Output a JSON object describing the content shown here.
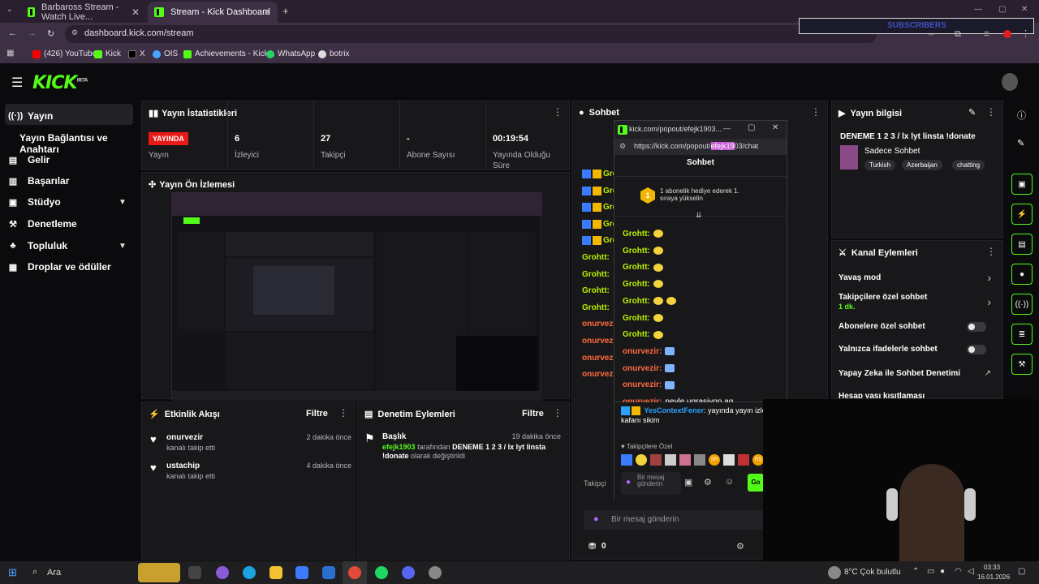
{
  "browser": {
    "tabs": [
      {
        "title": "Barbaross Stream - Watch Live..."
      },
      {
        "title": "Stream - Kick Dashboard"
      }
    ],
    "url": "dashboard.kick.com/stream",
    "bookmarks": [
      "(426) YouTube",
      "Kick",
      "X",
      "OIS",
      "Achievements - Kick...",
      "WhatsApp",
      "botrix"
    ]
  },
  "kick": {
    "logo": "KICK",
    "logo_sup": "BETA"
  },
  "sidebar": {
    "items": [
      {
        "label": "Yayın",
        "icon": "broadcast-icon"
      },
      {
        "label": "Yayın Bağlantısı ve Anahtarı",
        "icon": ""
      },
      {
        "label": "Gelir",
        "icon": "revenue-icon"
      },
      {
        "label": "Başarılar",
        "icon": "achievements-icon"
      },
      {
        "label": "Stüdyo",
        "icon": "studio-icon"
      },
      {
        "label": "Denetleme",
        "icon": "moderation-icon"
      },
      {
        "label": "Topluluk",
        "icon": "community-icon"
      },
      {
        "label": "Droplar ve ödüller",
        "icon": "drops-icon"
      }
    ]
  },
  "stats": {
    "title": "Yayın İstatistikleri",
    "live_badge": "YAYINDA",
    "live_label": "Yayın",
    "items": [
      {
        "value": "6",
        "label": "İzleyici"
      },
      {
        "value": "27",
        "label": "Takipçi"
      },
      {
        "value": "-",
        "label": "Abone Sayısı"
      },
      {
        "value": "00:19:54",
        "label": "Yayında Olduğu Süre"
      }
    ]
  },
  "preview": {
    "title": "Yayın Ön İzlemesi"
  },
  "activity": {
    "title": "Etkinlik Akışı",
    "filter": "Filtre",
    "items": [
      {
        "user": "onurvezir",
        "action": "kanalı takip etti",
        "time": "2 dakika önce"
      },
      {
        "user": "ustachip",
        "action": "kanalı takip etti",
        "time": "4 dakika önce"
      }
    ]
  },
  "modlog": {
    "title": "Denetim Eylemleri",
    "filter": "Filtre",
    "item": {
      "heading": "Başlık",
      "user": "efejk1903",
      "middle": "tarafından",
      "value": "DENEME 1 2 3 / lx lyt linsta !donate",
      "suffix": "olarak değiştirildi",
      "time": "19 dakika önce"
    }
  },
  "chat": {
    "title": "Sohbet",
    "bg_users": [
      "Grohtt:",
      "Grohtt:",
      "Grohtt:",
      "Grohtt:",
      "Grohtt:",
      "Grohtt:",
      "Grohtt:",
      "Grohtt:",
      "Grohtt:",
      "onurvezir",
      "onurvezir",
      "onurvezir",
      "onurvezir"
    ],
    "followers_only": "Takipçi",
    "input_placeholder": "Bir mesaj gönderin",
    "points": "0"
  },
  "popout": {
    "window_title": "kick.com/popout/efejk1903...",
    "url_prefix": "https://kick.com/popout/",
    "url_highlight": "efejk19",
    "url_suffix": "03/chat",
    "header": "Sohbet",
    "pinned_rank": "1",
    "pinned_text": "1 abonelik hediye ederek 1. sıraya yükselin",
    "messages": [
      {
        "user": "Grohtt:",
        "text": "",
        "emotes": 1
      },
      {
        "user": "Grohtt:",
        "text": "",
        "emotes": 1
      },
      {
        "user": "Grohtt:",
        "text": "",
        "emotes": 1
      },
      {
        "user": "Grohtt:",
        "text": "",
        "emotes": 1
      },
      {
        "user": "Grohtt:",
        "text": "",
        "emotes": 2
      },
      {
        "user": "Grohtt:",
        "text": "",
        "emotes": 1
      },
      {
        "user": "Grohtt:",
        "text": "",
        "emotes": 1
      },
      {
        "user": "onurvezir:",
        "text": "",
        "emotes": 1
      },
      {
        "user": "onurvezir:",
        "text": "",
        "emotes": 1
      },
      {
        "user": "onurvezir:",
        "text": "",
        "emotes": 1
      },
      {
        "user": "onurvezir:",
        "text": "neyle ugrasiyon aq",
        "emotes": 0
      }
    ],
    "highlight_user": "YesContextFener",
    "highlight_text": ": yayında yayın izleyen kafanı sikim",
    "followers_label": "Takipçilere Özel",
    "input_placeholder": "Bir mesaj gönderin",
    "send_label": "Go",
    "sr_badge": "SR",
    "rs_badge": "RS"
  },
  "info": {
    "title": "Yayın bilgisi",
    "stream_title": "DENEME 1 2 3 / lx lyt linsta !donate",
    "category": "Sadece Sohbet",
    "tags": [
      "Turkish",
      "Azerbaijan",
      "chatting"
    ]
  },
  "channel_actions": {
    "title": "Kanal Eylemleri",
    "items": [
      {
        "label": "Yavaş mod",
        "sub": "",
        "control": "arrow"
      },
      {
        "label": "Takipçilere özel sohbet",
        "sub": "1 dk.",
        "control": "arrow"
      },
      {
        "label": "Abonelere özel sohbet",
        "sub": "",
        "control": "toggle"
      },
      {
        "label": "Yalnızca ifadelerle sohbet",
        "sub": "",
        "control": "toggle"
      },
      {
        "label": "Yapay Zeka ile Sohbet Denetimi",
        "sub": "",
        "control": "external"
      },
      {
        "label": "Hesap yaşı kısıtlaması",
        "sub": "",
        "control": "arrow"
      }
    ]
  },
  "overlay": {
    "subscribers_label": "SUBSCRIBERS"
  },
  "taskbar": {
    "search": "Ara",
    "weather": "8°C  Çok bulutlu",
    "time": "03:33",
    "date": "16.01.2026"
  },
  "colors": {
    "brand": "#53fc18",
    "live": "#e91916",
    "panel": "#18181b",
    "chrome": "#3d2f44"
  }
}
